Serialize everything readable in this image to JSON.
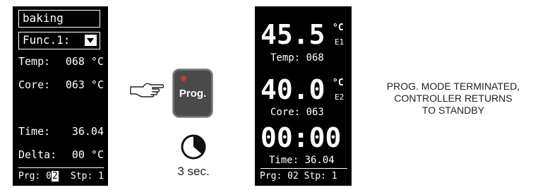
{
  "standby_panel": {
    "mode_name": "baking",
    "function_label": "Func.1:",
    "temp": {
      "label": "Temp:",
      "value": "068 °C"
    },
    "core": {
      "label": "Core:",
      "value": "063 °C"
    },
    "time": {
      "label": "Time:",
      "value": "36.04"
    },
    "delta": {
      "label": "Delta:",
      "value": "00 °C"
    },
    "program": {
      "prefix": "Prg: 0",
      "highlight": "2",
      "step": "Stp:  1"
    }
  },
  "prog_button": {
    "label": "Prog.",
    "led_color": "#c83a2a"
  },
  "hold": {
    "duration_label": "3 sec."
  },
  "running_panel": {
    "e1": {
      "value": "45.5",
      "unit": "°C",
      "label": "E1",
      "caption": "Temp:  068"
    },
    "e2": {
      "value": "40.0",
      "unit": "°C",
      "label": "E2",
      "caption": "Core:  063"
    },
    "clock": {
      "value": "00:00",
      "caption": "Time: 36.04"
    },
    "program": "Prg: 02  Stp:  1"
  },
  "message": {
    "lines": [
      "PROG. MODE TERMINATED,",
      "CONTROLLER RETURNS",
      "TO STANDBY"
    ]
  }
}
